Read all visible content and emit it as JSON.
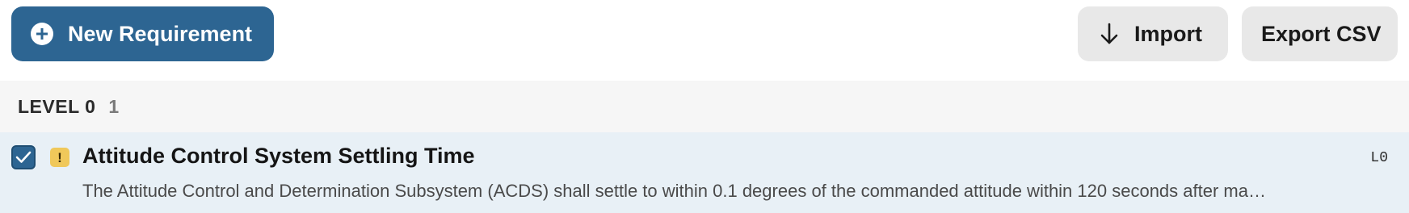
{
  "toolbar": {
    "new_requirement_label": "New Requirement",
    "import_label": "Import",
    "export_label": "Export CSV"
  },
  "group": {
    "title": "LEVEL 0",
    "count": "1"
  },
  "requirements": [
    {
      "checked": true,
      "warning": "!",
      "title": "Attitude Control System Settling Time",
      "level": "L0",
      "description": "The Attitude Control and Determination Subsystem (ACDS) shall settle to within 0.1 degrees of the commanded attitude within 120 seconds after ma…"
    }
  ],
  "colors": {
    "primary": "#2d6592",
    "secondary_button": "#e8e8e8",
    "group_header_bg": "#f6f6f6",
    "selected_row_bg": "#e8f0f6",
    "warning": "#f0c85a"
  }
}
